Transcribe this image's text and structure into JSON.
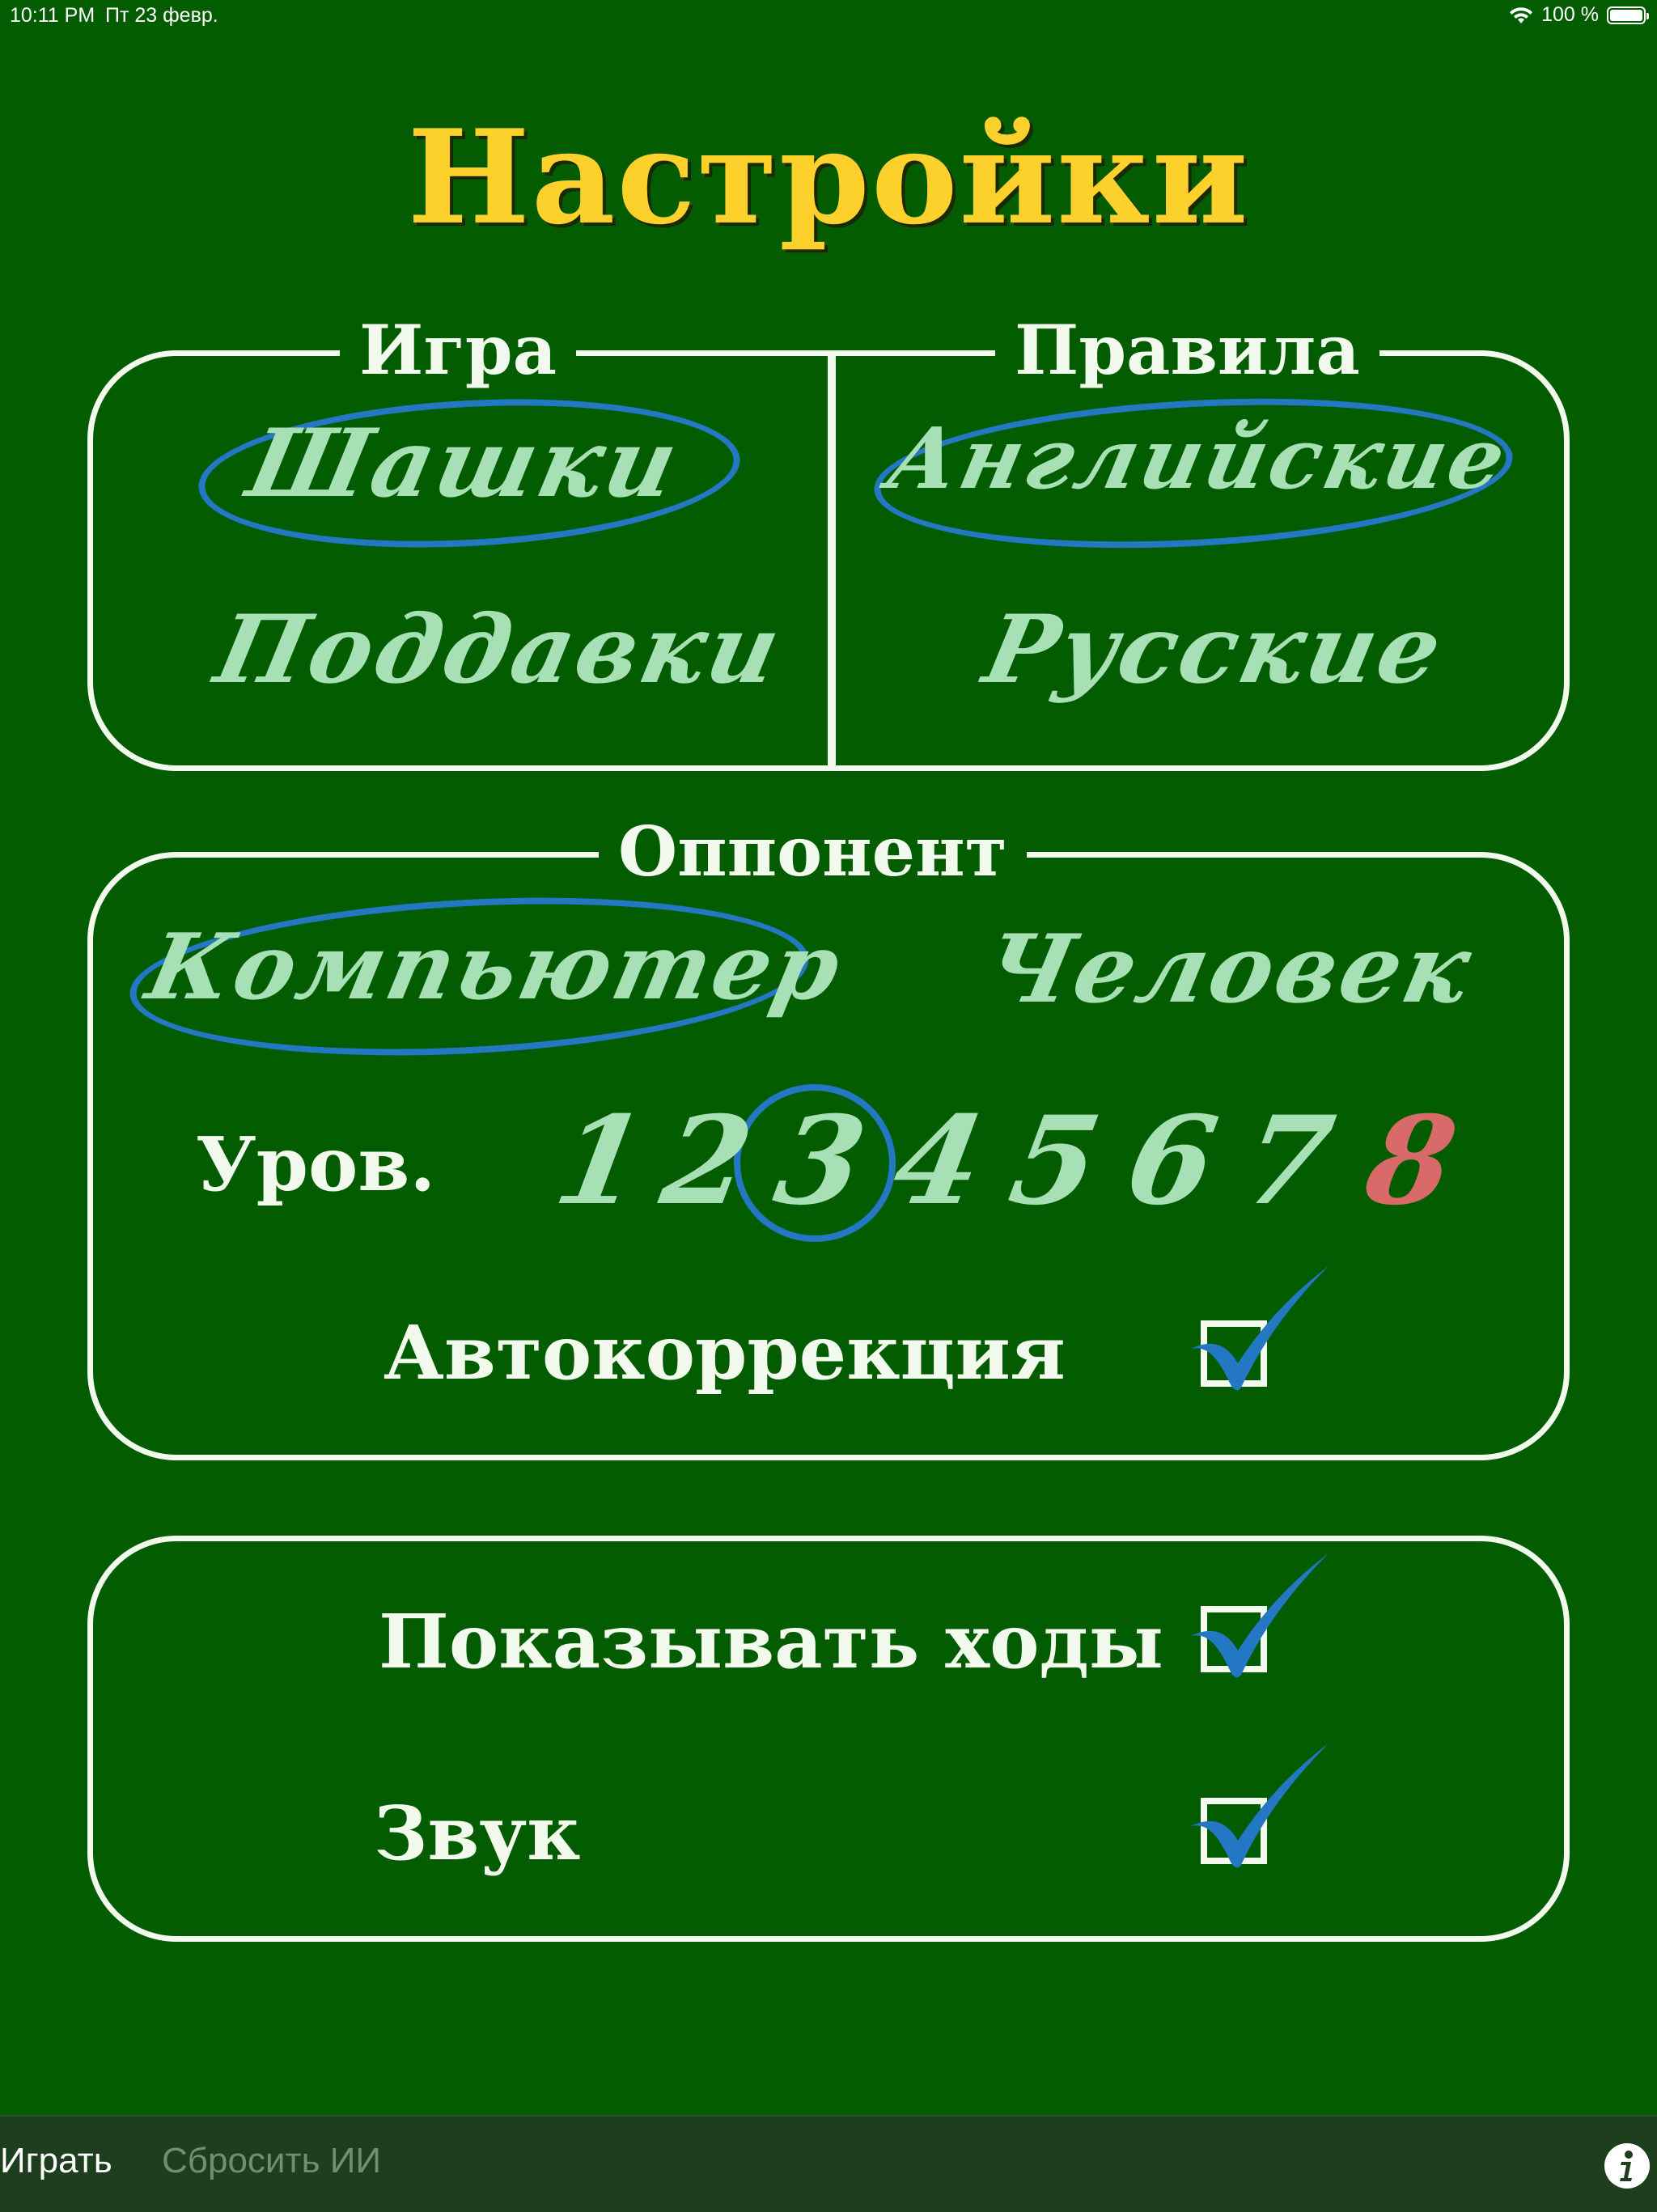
{
  "status_bar": {
    "time": "10:11 PM",
    "date": "Пт 23 февр.",
    "battery": "100 %"
  },
  "title": "Настройки",
  "game_section": {
    "label": "Игра",
    "options": [
      "Шашки",
      "Поддавки"
    ],
    "selected": "Шашки"
  },
  "rules_section": {
    "label": "Правила",
    "options": [
      "Английские",
      "Русские"
    ],
    "selected": "Английские"
  },
  "opponent_section": {
    "label": "Оппонент",
    "options": [
      "Компьютер",
      "Человек"
    ],
    "selected": "Компьютер",
    "level_label": "Уров.",
    "levels": [
      "1",
      "2",
      "3",
      "4",
      "5",
      "6",
      "7",
      "8"
    ],
    "selected_level": "3",
    "autocorrect_label": "Автокоррекция",
    "autocorrect_checked": true
  },
  "options_section": {
    "show_moves_label": "Показывать ходы",
    "show_moves_checked": true,
    "sound_label": "Звук",
    "sound_checked": true
  },
  "toolbar": {
    "play_label": "Играть",
    "reset_ai_label": "Сбросить ИИ"
  },
  "colors": {
    "background": "#035c00",
    "title": "#fdd12b",
    "frame": "#f2faee",
    "script_text": "#a7e0b4",
    "selection": "#2477c2",
    "max_level": "#d96a6a",
    "toolbar": "#1d3f1d"
  },
  "icons": [
    "wifi-icon",
    "battery-icon",
    "checkmark-icon",
    "info-icon"
  ]
}
